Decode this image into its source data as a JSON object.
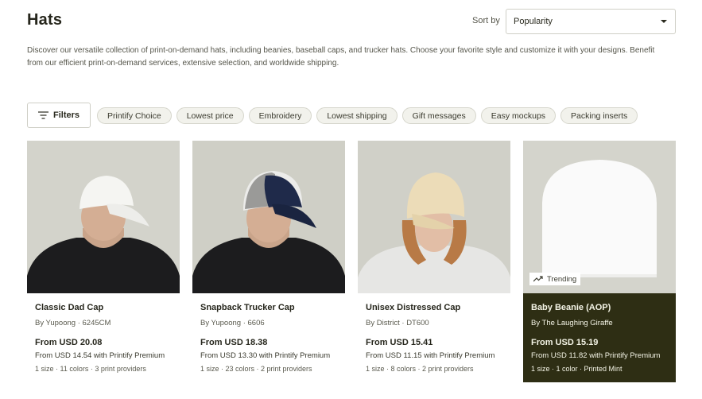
{
  "page": {
    "title": "Hats",
    "description": "Discover our versatile collection of print-on-demand hats, including beanies, baseball caps, and trucker hats. Choose your favorite style and customize it with your designs. Benefit from our efficient print-on-demand services, extensive selection, and worldwide shipping."
  },
  "sort": {
    "label": "Sort by",
    "value": "Popularity"
  },
  "filters": {
    "button_label": "Filters",
    "chips": [
      "Printify Choice",
      "Lowest price",
      "Embroidery",
      "Lowest shipping",
      "Gift messages",
      "Easy mockups",
      "Packing inserts"
    ]
  },
  "products": [
    {
      "name": "Classic Dad Cap",
      "by": "By Yupoong · 6245CM",
      "price": "From USD 20.08",
      "premium": "From USD 14.54 with Printify Premium",
      "meta": "1 size · 11 colors · 3 print providers"
    },
    {
      "name": "Snapback Trucker Cap",
      "by": "By Yupoong · 6606",
      "price": "From USD 18.38",
      "premium": "From USD 13.30 with Printify Premium",
      "meta": "1 size · 23 colors · 2 print providers"
    },
    {
      "name": "Unisex Distressed Cap",
      "by": "By District · DT600",
      "price": "From USD 15.41",
      "premium": "From USD 11.15 with Printify Premium",
      "meta": "1 size · 8 colors · 2 print providers"
    },
    {
      "name": "Baby Beanie (AOP)",
      "by": "By The Laughing Giraffe",
      "price": "From USD 15.19",
      "premium": "From USD 11.82 with Printify Premium",
      "meta": "1 size · 1 color · Printed Mint",
      "badge": "Trending"
    }
  ],
  "icons": {
    "filter": "filter-lines-icon",
    "caret": "chevron-down-icon",
    "trending": "trending-up-icon"
  },
  "colors": {
    "featured_card": "#2e2e14",
    "chip_bg": "#f2f2ec"
  }
}
